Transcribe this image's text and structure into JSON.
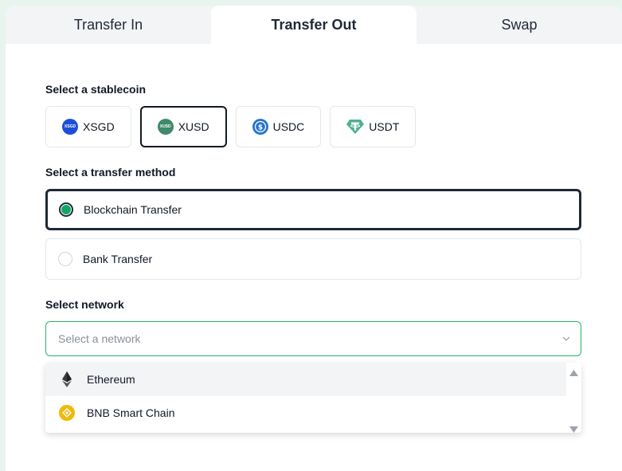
{
  "tabs": [
    {
      "label": "Transfer In",
      "active": false
    },
    {
      "label": "Transfer Out",
      "active": true
    },
    {
      "label": "Swap",
      "active": false
    }
  ],
  "stablecoin": {
    "label": "Select a stablecoin",
    "options": [
      {
        "label": "XSGD",
        "icon_text": "XSGD",
        "color": "#1d4ed8",
        "selected": false
      },
      {
        "label": "XUSD",
        "icon_text": "XUSD",
        "color": "#3f8a68",
        "selected": true
      },
      {
        "label": "USDC",
        "icon": "usdc-icon",
        "color": "#2775ca",
        "selected": false
      },
      {
        "label": "USDT",
        "icon": "tether-icon",
        "color": "#50af95",
        "selected": false
      }
    ]
  },
  "method": {
    "label": "Select a transfer method",
    "options": [
      {
        "label": "Blockchain Transfer",
        "selected": true
      },
      {
        "label": "Bank Transfer",
        "selected": false
      }
    ]
  },
  "network": {
    "label": "Select network",
    "placeholder": "Select a network",
    "options": [
      {
        "label": "Ethereum",
        "icon": "ethereum-icon"
      },
      {
        "label": "BNB Smart Chain",
        "icon": "bnb-icon",
        "color": "#f0b90b"
      }
    ]
  },
  "colors": {
    "accent": "#10a765",
    "focus_border": "#27b46e",
    "background": "#e8f5ee"
  }
}
